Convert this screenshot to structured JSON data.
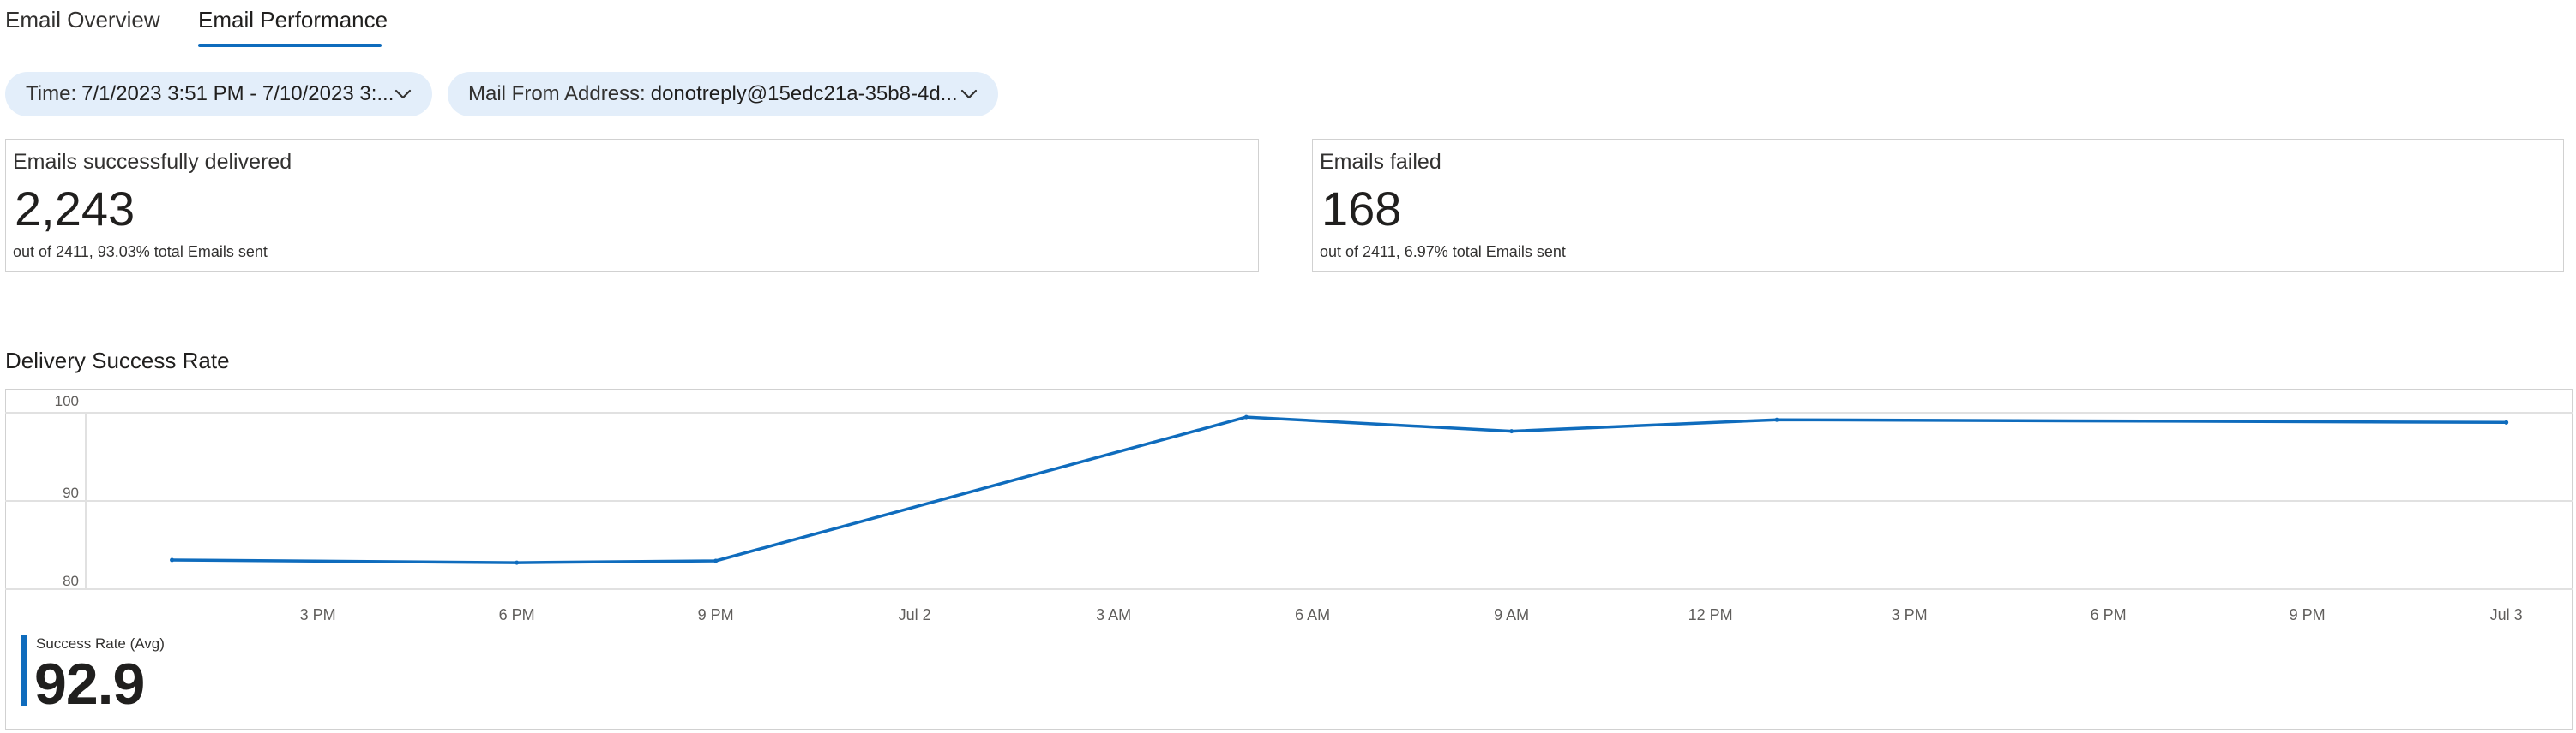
{
  "tabs": [
    {
      "label": "Email Overview",
      "active": false
    },
    {
      "label": "Email Performance",
      "active": true
    }
  ],
  "filters": {
    "time": {
      "key": "Time:",
      "value": "7/1/2023 3:51 PM - 7/10/2023 3:..."
    },
    "mail_from": {
      "key": "Mail From Address:",
      "value": "donotreply@15edc21a-35b8-4d..."
    }
  },
  "kpis": {
    "delivered": {
      "title": "Emails successfully delivered",
      "value": "2,243",
      "subtitle": "out of 2411, 93.03% total Emails sent"
    },
    "failed": {
      "title": "Emails failed",
      "value": "168",
      "subtitle": "out of 2411, 6.97% total Emails sent"
    }
  },
  "section": {
    "title": "Delivery Success Rate"
  },
  "metric": {
    "label": "Success Rate (Avg)",
    "value": "92.9"
  },
  "colors": {
    "accent": "#0f6cbd",
    "series": "#0f6cbd",
    "grid": "#e1e1e1",
    "pill_bg": "#e3eefa"
  },
  "icons": {
    "dropdown": "chevron-down-icon"
  },
  "chart_data": {
    "type": "line",
    "title": "",
    "ylim": [
      80,
      100
    ],
    "yticks": [
      "100",
      "90",
      "80"
    ],
    "ytick_values": [
      100,
      90,
      80
    ],
    "xtick_labels": [
      "3 PM",
      "6 PM",
      "9 PM",
      "Jul 2",
      "3 AM",
      "6 AM",
      "9 AM",
      "12 PM",
      "3 PM",
      "6 PM",
      "9 PM",
      "Jul 3"
    ],
    "x_range_hours": [
      -3.5,
      34
    ],
    "grid": true,
    "series": [
      {
        "x": [
          "7/1 12:30 PM",
          "7/1 6:00 PM",
          "7/1 9:00 PM",
          "7/2 5:00 AM",
          "7/2 9:00 AM",
          "7/2 1:00 PM",
          "7/3 12:30 AM"
        ],
        "x_hours": [
          -2.2,
          3,
          6,
          14,
          18,
          22,
          33
        ],
        "values": [
          83.3,
          83.0,
          83.2,
          99.5,
          97.9,
          99.2,
          98.9
        ]
      }
    ]
  }
}
